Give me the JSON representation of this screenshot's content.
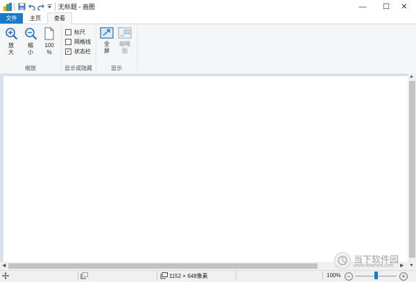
{
  "window": {
    "title": "无标题 - 画图",
    "minimize": "—",
    "maximize": "☐",
    "close": "✕"
  },
  "tabs": [
    {
      "label": "文件"
    },
    {
      "label": "主页"
    },
    {
      "label": "查看"
    }
  ],
  "ribbon": {
    "zoom_group": {
      "label": "缩放",
      "zoom_in": {
        "line1": "放",
        "line2": "大"
      },
      "zoom_out": {
        "line1": "缩",
        "line2": "小"
      },
      "zoom_100": {
        "line1": "100",
        "line2": "%"
      }
    },
    "show_hide_group": {
      "label": "显示或隐藏",
      "rulers": {
        "label": "标尺",
        "checked": false
      },
      "gridlines": {
        "label": "网格线",
        "checked": false
      },
      "status_bar": {
        "label": "状态栏",
        "checked": true
      }
    },
    "display_group": {
      "label": "显示",
      "fullscreen": {
        "line1": "全",
        "line2": "屏"
      },
      "thumbnail": {
        "line1": "缩略",
        "line2": "图"
      }
    }
  },
  "status": {
    "canvas_size": "1152 × 648像素",
    "zoom_level": "100%",
    "zoom_slider_value": 0.5,
    "zoom_minus": "−",
    "zoom_plus": "+"
  },
  "watermark": {
    "name": "当下软件园",
    "url": "www.downxia.com"
  },
  "colors": {
    "accent": "#1979ca",
    "ribbon_bg": "#f5f6f7",
    "workspace_bg": "#d9e1ec",
    "slider_thumb": "#1979ca"
  }
}
